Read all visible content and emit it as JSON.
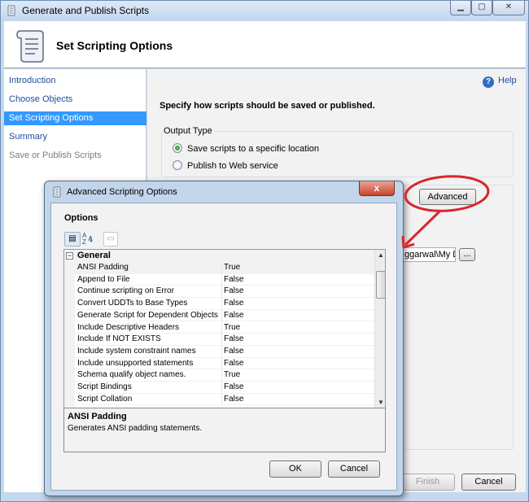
{
  "window": {
    "title": "Generate and Publish Scripts",
    "header_title": "Set Scripting Options"
  },
  "nav": {
    "items": [
      {
        "label": "Introduction",
        "state": "normal"
      },
      {
        "label": "Choose Objects",
        "state": "normal"
      },
      {
        "label": "Set Scripting Options",
        "state": "active"
      },
      {
        "label": "Summary",
        "state": "normal"
      },
      {
        "label": "Save or Publish Scripts",
        "state": "disabled"
      }
    ]
  },
  "main": {
    "help": "Help",
    "instruction": "Specify how scripts should be saved or published.",
    "output_type": {
      "label": "Output Type",
      "options": [
        {
          "label": "Save scripts to a specific location",
          "checked": true
        },
        {
          "label": "Publish to Web service",
          "checked": false
        }
      ]
    },
    "advanced_button": "Advanced",
    "path_value": "ggarwal\\My Dc",
    "browse_button": "...",
    "finish_button": "Finish",
    "cancel_button": "Cancel"
  },
  "dialog": {
    "title": "Advanced Scripting Options",
    "options_label": "Options",
    "close_glyph": "x",
    "category": "General",
    "category_toggle": "−",
    "properties": [
      {
        "name": "ANSI Padding",
        "value": "True"
      },
      {
        "name": "Append to File",
        "value": "False"
      },
      {
        "name": "Continue scripting on Error",
        "value": "False"
      },
      {
        "name": "Convert UDDTs to Base Types",
        "value": "False"
      },
      {
        "name": "Generate Script for Dependent Objects",
        "value": "False"
      },
      {
        "name": "Include Descriptive Headers",
        "value": "True"
      },
      {
        "name": "Include If NOT EXISTS",
        "value": "False"
      },
      {
        "name": "Include system constraint names",
        "value": "False"
      },
      {
        "name": "Include unsupported statements",
        "value": "False"
      },
      {
        "name": "Schema qualify object names.",
        "value": "True"
      },
      {
        "name": "Script Bindings",
        "value": "False"
      },
      {
        "name": "Script Collation",
        "value": "False"
      }
    ],
    "selected_property": "ANSI Padding",
    "description_title": "ANSI Padding",
    "description_text": "Generates ANSI padding statements.",
    "ok_button": "OK",
    "cancel_button": "Cancel"
  },
  "colors": {
    "annotation": "#d9262c",
    "selected_nav": "#3399ff",
    "link": "#1e4d9b"
  }
}
